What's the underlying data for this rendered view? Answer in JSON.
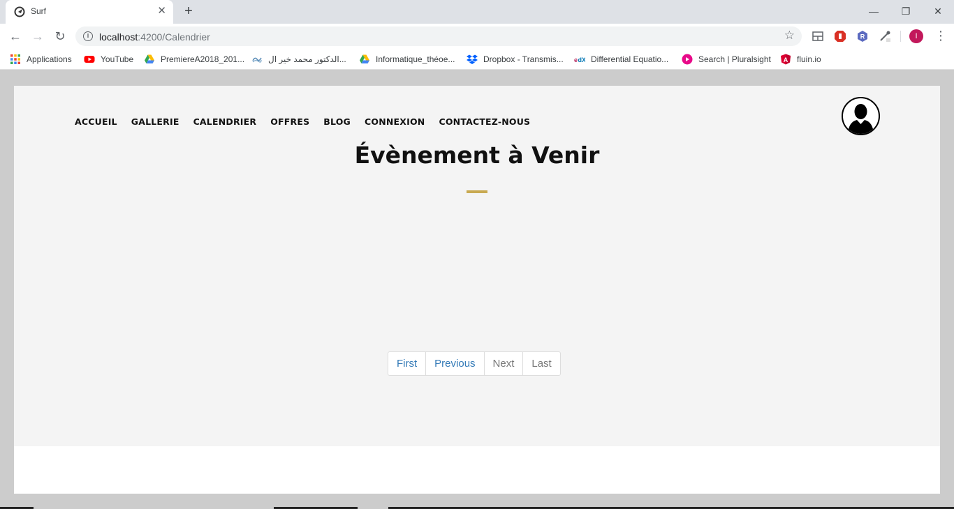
{
  "browser": {
    "tab_title": "Surf",
    "url_host": "localhost",
    "url_rest": ":4200/Calendrier",
    "profile_initial": "I",
    "bookmarks": [
      {
        "label": "Applications",
        "icon": "apps-grid-icon"
      },
      {
        "label": "YouTube",
        "icon": "youtube-icon"
      },
      {
        "label": "PremiereA2018_201...",
        "icon": "google-drive-icon"
      },
      {
        "label": "الدكتور محمد خير ال...",
        "icon": "site-icon"
      },
      {
        "label": "Informatique_théoe...",
        "icon": "google-drive-icon"
      },
      {
        "label": "Dropbox - Transmis...",
        "icon": "dropbox-icon"
      },
      {
        "label": "Differential Equatio...",
        "icon": "edx-icon"
      },
      {
        "label": "Search | Pluralsight",
        "icon": "pluralsight-icon"
      },
      {
        "label": "fluin.io",
        "icon": "angular-icon"
      }
    ]
  },
  "site": {
    "nav": [
      "ACCUEIL",
      "GALLERIE",
      "CALENDRIER",
      "OFFRES",
      "BLOG",
      "CONNEXION",
      "CONTACTEZ-NOUS"
    ],
    "title": "Évènement à Venir",
    "accent_color": "#c8a951",
    "pagination": [
      "First",
      "Previous",
      "Next",
      "Last"
    ]
  }
}
